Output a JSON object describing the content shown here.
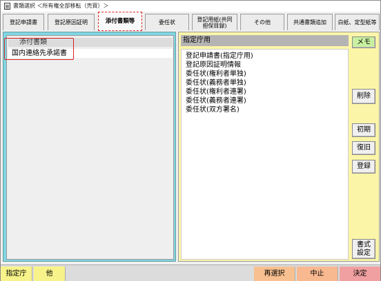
{
  "window": {
    "title": "書類選択 ＜所有権全部移転（売買）＞"
  },
  "tabs": [
    {
      "label": "登記申請書"
    },
    {
      "label": "登記原因証明"
    },
    {
      "label": "添付書類等"
    },
    {
      "label": "委任状"
    },
    {
      "label": "登記用紙(共同担保目録)"
    },
    {
      "label": "その他"
    },
    {
      "label": "共通書類追加"
    },
    {
      "label": "白紙、定型紙等"
    }
  ],
  "left_panel": {
    "header": "添付書類",
    "items": [
      "国内連絡先承諾書"
    ]
  },
  "right_panel": {
    "header": "指定庁用",
    "items": [
      "登記申請書(指定庁用)",
      "登記原因証明情報",
      "委任状(権利者単独)",
      "委任状(義務者単独)",
      "委任状(権利者連署)",
      "委任状(義務者連署)",
      "委任状(双方署名)"
    ]
  },
  "side_buttons": {
    "memo": "メモ",
    "delete": "削除",
    "init": "初期",
    "restore": "復旧",
    "register": "登録",
    "format_line1": "書式",
    "format_line2": "設定"
  },
  "bottom": {
    "shiteicho": "指定庁",
    "other": "他",
    "reselect": "再選択",
    "cancel": "中止",
    "decide": "決定"
  },
  "colors": {
    "left_panel_bg": "#7fd6e2",
    "right_panel_bg": "#fbf5a8",
    "memo_button": "#c8f0a0",
    "shiteicho_button": "#f7f38a",
    "reselect_button": "#f8c090",
    "cancel_button": "#f8b890",
    "decide_button": "#f0a0a0",
    "highlight_red": "#d82020"
  }
}
